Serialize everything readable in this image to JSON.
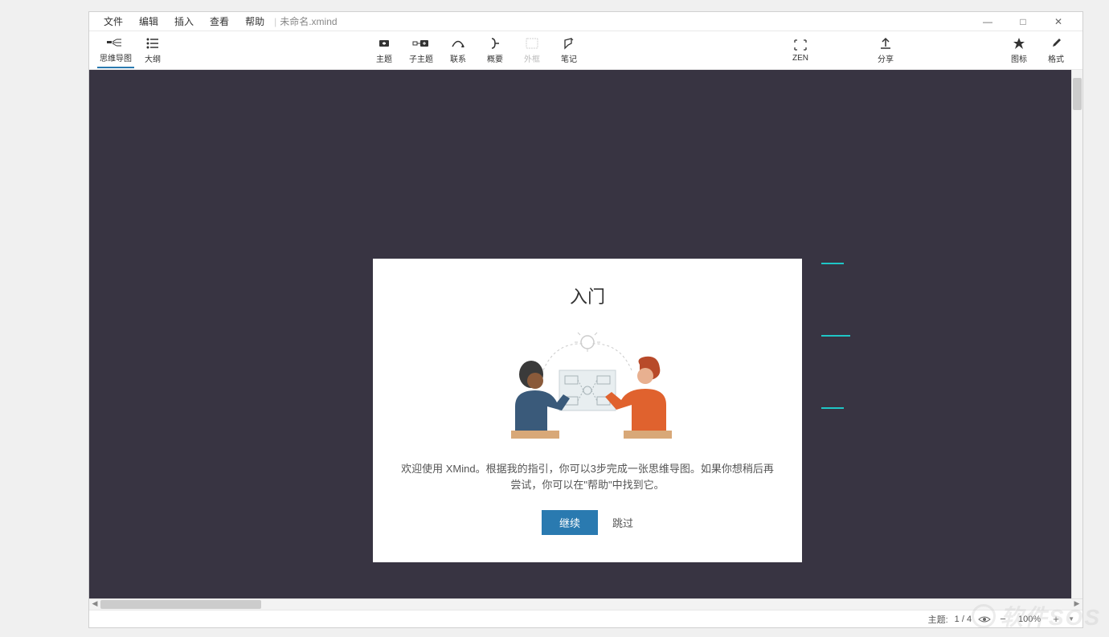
{
  "menubar": {
    "items": [
      "文件",
      "编辑",
      "插入",
      "查看",
      "帮助"
    ],
    "doc_title": "未命名.xmind"
  },
  "window_controls": {
    "min": "—",
    "max": "□",
    "close": "✕"
  },
  "toolbar": {
    "view": [
      {
        "name": "mindmap-view",
        "label": "思维导图",
        "active": true
      },
      {
        "name": "outline-view",
        "label": "大纲",
        "active": false
      }
    ],
    "edit": [
      {
        "name": "topic",
        "label": "主题"
      },
      {
        "name": "subtopic",
        "label": "子主题"
      },
      {
        "name": "relationship",
        "label": "联系"
      },
      {
        "name": "summary",
        "label": "概要"
      },
      {
        "name": "boundary",
        "label": "外框",
        "disabled": true
      },
      {
        "name": "notes",
        "label": "笔记"
      }
    ],
    "right": [
      {
        "name": "zen",
        "label": "ZEN"
      },
      {
        "name": "share",
        "label": "分享"
      },
      {
        "name": "icons",
        "label": "图标"
      },
      {
        "name": "format",
        "label": "格式"
      }
    ]
  },
  "onboard": {
    "title": "入门",
    "text": "欢迎使用 XMind。根据我的指引，你可以3步完成一张思维导图。如果你想稍后再尝试，你可以在\"帮助\"中找到它。",
    "continue": "继续",
    "skip": "跳过"
  },
  "statusbar": {
    "topic_label": "主题:",
    "topic_count": "1 / 4",
    "zoom": "100%"
  },
  "watermark": "软件SOS"
}
